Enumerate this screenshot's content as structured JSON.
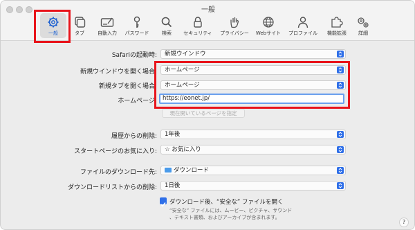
{
  "window": {
    "title": "一般"
  },
  "toolbar": {
    "tabs": [
      {
        "label": "一般",
        "icon": "gear-icon",
        "active": true
      },
      {
        "label": "タブ",
        "icon": "tabs-icon"
      },
      {
        "label": "自動入力",
        "icon": "autofill-icon"
      },
      {
        "label": "パスワード",
        "icon": "key-icon"
      },
      {
        "label": "検索",
        "icon": "search-icon"
      },
      {
        "label": "セキュリティ",
        "icon": "lock-icon"
      },
      {
        "label": "プライバシー",
        "icon": "hand-icon"
      },
      {
        "label": "Webサイト",
        "icon": "globe-icon"
      },
      {
        "label": "プロファイル",
        "icon": "person-icon"
      },
      {
        "label": "機能拡張",
        "icon": "puzzle-icon"
      },
      {
        "label": "詳細",
        "icon": "gears-icon"
      }
    ]
  },
  "settings": {
    "startup": {
      "label": "Safariの起動時:",
      "value": "新規ウインドウ"
    },
    "new_window": {
      "label": "新規ウインドウを開く場合:",
      "value": "ホームページ"
    },
    "new_tab": {
      "label": "新規タブを開く場合:",
      "value": "ホームページ"
    },
    "homepage": {
      "label": "ホームページ:",
      "value": "https://eonet.jp/",
      "button": "現在開いているページを指定"
    },
    "remove_history": {
      "label": "履歴からの削除:",
      "value": "1年後"
    },
    "start_favorites": {
      "label": "スタートページのお気に入り:",
      "value": "お気に入り"
    },
    "download_location": {
      "label": "ファイルのダウンロード先:",
      "value": "ダウンロード"
    },
    "remove_downloads": {
      "label": "ダウンロードリストからの削除:",
      "value": "1日後"
    },
    "open_safe": {
      "label": "ダウンロード後、“安全な” ファイルを開く",
      "checked": true,
      "note_line1": "“安全な” ファイルには、ムービー、ピクチャ、サウンド",
      "note_line2": "、テキスト書類、およびアーカイブが含まれます。"
    }
  },
  "help": {
    "label": "?"
  },
  "colors": {
    "accent": "#2f6fe8",
    "highlight": "#e8141b"
  }
}
